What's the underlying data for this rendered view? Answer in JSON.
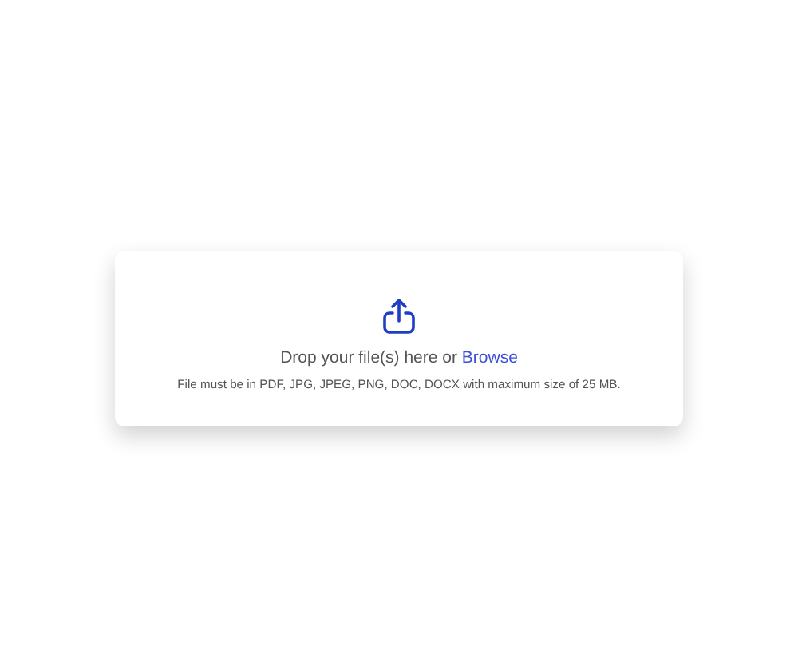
{
  "dropzone": {
    "prompt": "Drop your file(s) here or",
    "browse_link": "Browse",
    "hint": "File must be in PDF, JPG, JPEG, PNG, DOC, DOCX with maximum size of 25 MB."
  }
}
